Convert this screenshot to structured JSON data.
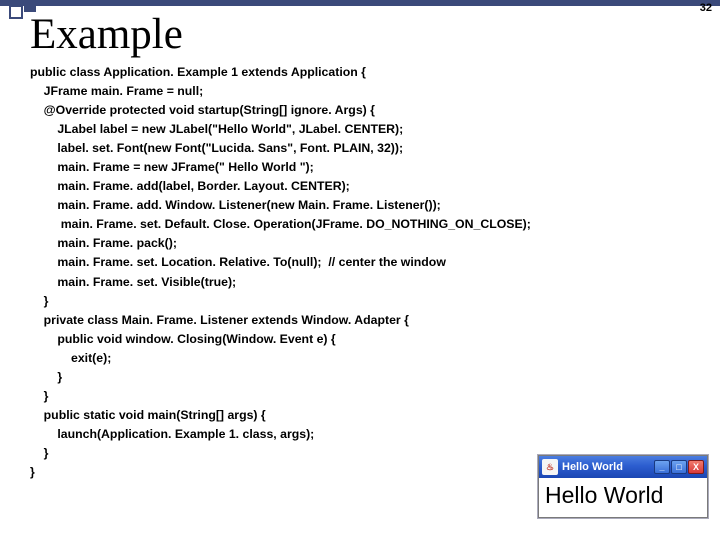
{
  "page_number": "32",
  "title": "Example",
  "code": {
    "l01": "public class Application. Example 1 extends Application {",
    "l02": "    JFrame main. Frame = null;",
    "l03": "    @Override protected void startup(String[] ignore. Args) {",
    "l04": "        JLabel label = new JLabel(\"Hello World\", JLabel. CENTER);",
    "l05": "        label. set. Font(new Font(\"Lucida. Sans\", Font. PLAIN, 32));",
    "l06": "        main. Frame = new JFrame(\" Hello World \");",
    "l07": "        main. Frame. add(label, Border. Layout. CENTER);",
    "l08": "        main. Frame. add. Window. Listener(new Main. Frame. Listener());",
    "l09": "         main. Frame. set. Default. Close. Operation(JFrame. DO_NOTHING_ON_CLOSE);",
    "l10": "        main. Frame. pack();",
    "l11": "        main. Frame. set. Location. Relative. To(null);  // center the window",
    "l12": "        main. Frame. set. Visible(true);",
    "l13": "    }",
    "l14": "    private class Main. Frame. Listener extends Window. Adapter {",
    "l15": "        public void window. Closing(Window. Event e) {",
    "l16": "            exit(e);",
    "l17": "        }",
    "l18": "    }",
    "l19": "    public static void main(String[] args) {",
    "l20": "        launch(Application. Example 1. class, args);",
    "l21": "    }",
    "l22": "}"
  },
  "app": {
    "title": "Hello World",
    "body": "Hello World",
    "java_icon_glyph": "♨",
    "min_glyph": "_",
    "max_glyph": "□",
    "close_glyph": "X"
  }
}
